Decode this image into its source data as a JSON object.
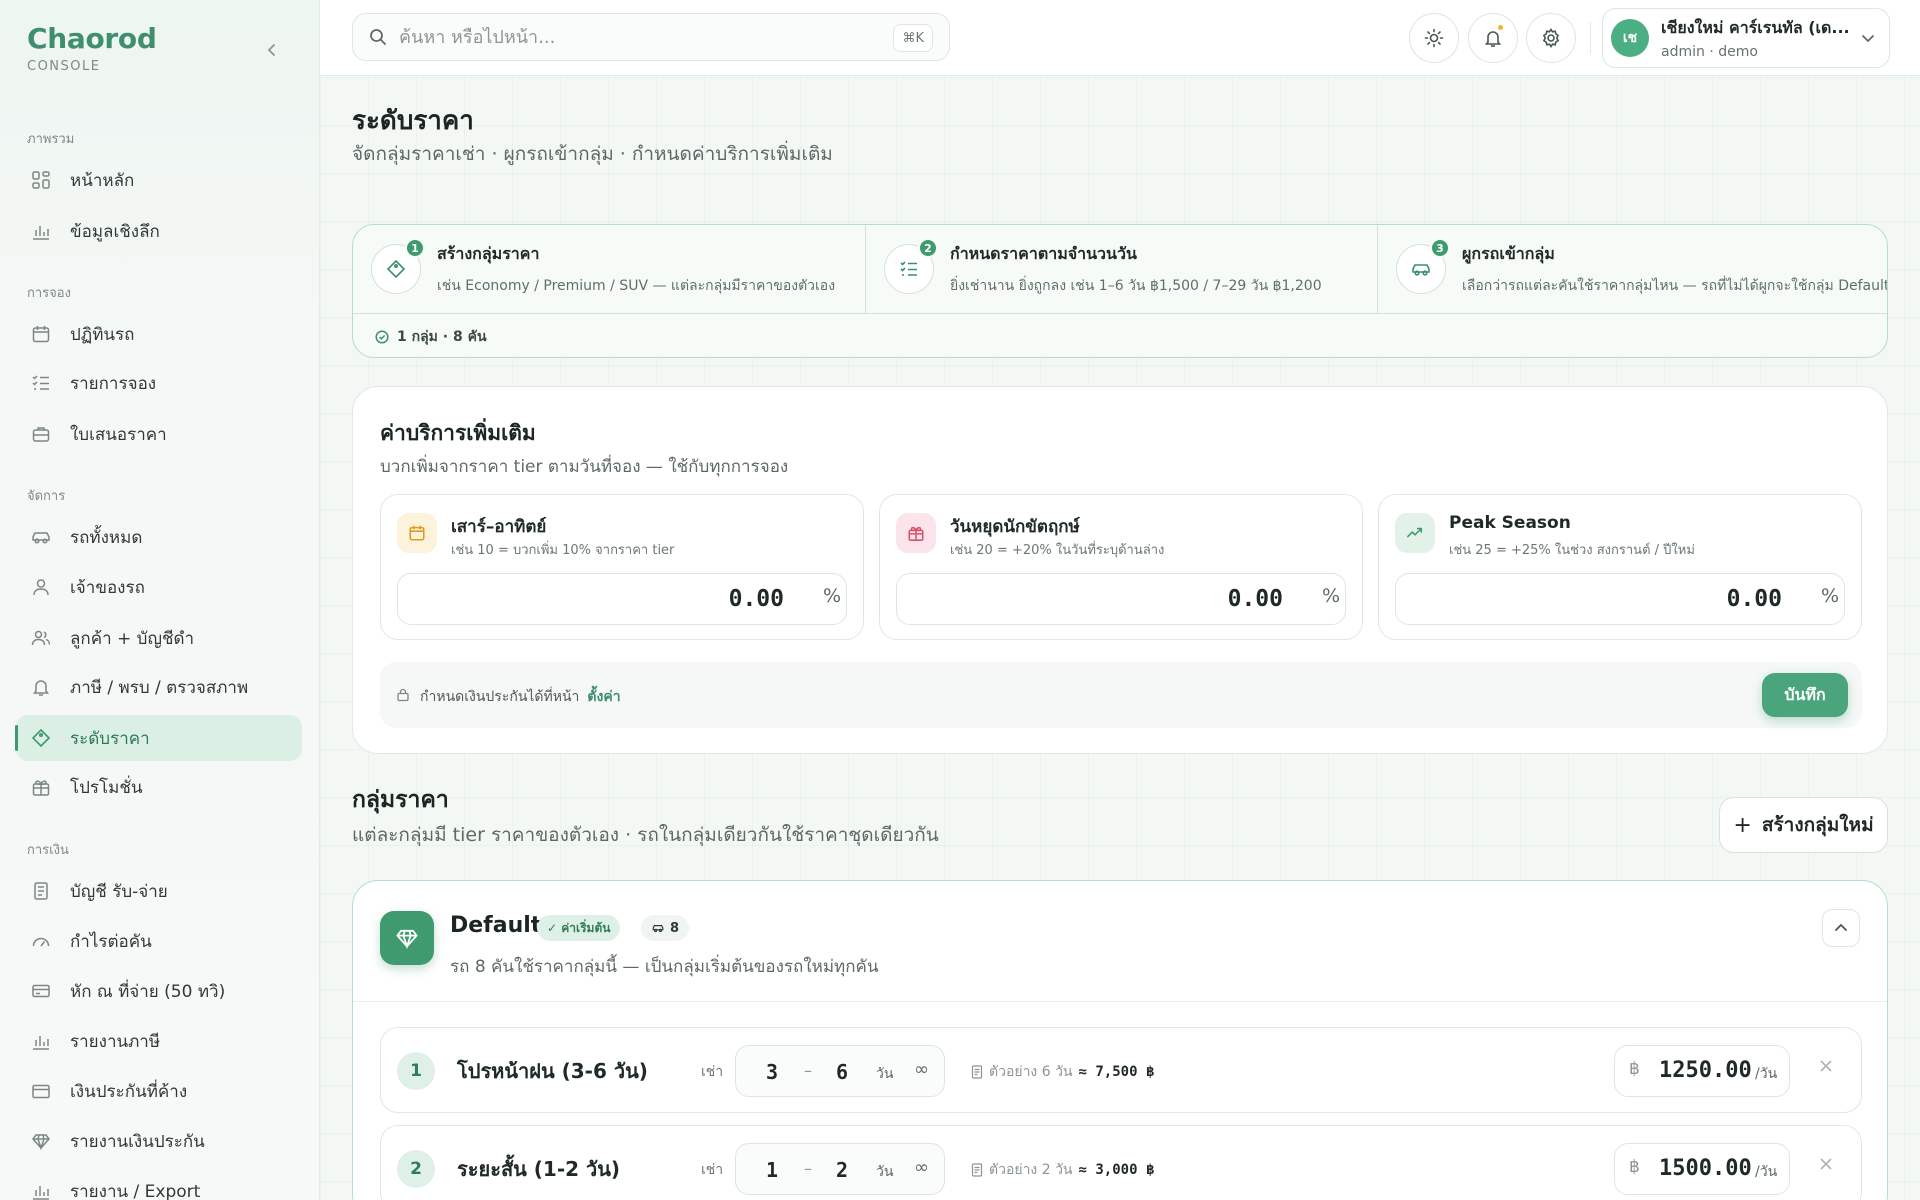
{
  "brand": {
    "name": "Chaorod",
    "sub": "CONSOLE"
  },
  "sidebar": {
    "sections": [
      {
        "label": "ภาพรวม"
      },
      {
        "label": "การจอง"
      },
      {
        "label": "จัดการ"
      },
      {
        "label": "การเงิน"
      }
    ],
    "items": [
      {
        "label": "หน้าหลัก",
        "icon": "grid-icon"
      },
      {
        "label": "ข้อมูลเชิงลึก",
        "icon": "bar-chart-icon"
      },
      {
        "label": "ปฏิทินรถ",
        "icon": "calendar-icon"
      },
      {
        "label": "รายการจอง",
        "icon": "list-check-icon"
      },
      {
        "label": "ใบเสนอราคา",
        "icon": "briefcase-icon"
      },
      {
        "label": "รถทั้งหมด",
        "icon": "car-icon"
      },
      {
        "label": "เจ้าของรถ",
        "icon": "user-icon"
      },
      {
        "label": "ลูกค้า + บัญชีดำ",
        "icon": "users-icon"
      },
      {
        "label": "ภาษี / พรบ / ตรวจสภาพ",
        "icon": "bell-icon"
      },
      {
        "label": "ระดับราคา",
        "icon": "tag-icon"
      },
      {
        "label": "โปรโมชั่น",
        "icon": "gift-icon"
      },
      {
        "label": "บัญชี รับ-จ่าย",
        "icon": "ledger-icon"
      },
      {
        "label": "กำไรต่อคัน",
        "icon": "gauge-icon"
      },
      {
        "label": "หัก ณ ที่จ่าย (50 ทวิ)",
        "icon": "card-icon"
      },
      {
        "label": "รายงานภาษี",
        "icon": "bar-chart-icon"
      },
      {
        "label": "เงินประกันที่ค้าง",
        "icon": "wallet-icon"
      },
      {
        "label": "รายงานเงินประกัน",
        "icon": "diamond-icon"
      },
      {
        "label": "รายงาน / Export",
        "icon": "bar-chart-icon"
      }
    ]
  },
  "topbar": {
    "search_placeholder": "ค้นหา หรือไปหน้า...",
    "search_kbd": "⌘K",
    "account_name": "เชียงใหม่ คาร์เรนทัล (เด...",
    "account_role": "admin · demo",
    "avatar_initials": "เช"
  },
  "page": {
    "title": "ระดับราคา",
    "subtitle": "จัดกลุ่มราคาเช่า · ผูกรถเข้ากลุ่ม · กำหนดค่าบริการเพิ่มเติม"
  },
  "steps": {
    "items": [
      {
        "num": "1",
        "title": "สร้างกลุ่มราคา",
        "desc": "เช่น Economy / Premium / SUV — แต่ละกลุ่มมีราคาของตัวเอง"
      },
      {
        "num": "2",
        "title": "กำหนดราคาตามจำนวนวัน",
        "desc": "ยิ่งเช่านาน ยิ่งถูกลง เช่น 1–6 วัน ฿1,500 / 7–29 วัน ฿1,200"
      },
      {
        "num": "3",
        "title": "ผูกรถเข้ากลุ่ม",
        "desc": "เลือกว่ารถแต่ละคันใช้ราคากลุ่มไหน — รถที่ไม่ได้ผูกจะใช้กลุ่ม Default"
      }
    ],
    "summary": "1 กลุ่ม · 8 คัน"
  },
  "fees": {
    "title": "ค่าบริการเพิ่มเติม",
    "subtitle": "บวกเพิ่มจากราคา tier ตามวันที่จอง — ใช้กับทุกการจอง",
    "items": [
      {
        "label": "เสาร์–อาทิตย์",
        "hint": "เช่น 10 = บวกเพิ่ม 10% จากราคา tier",
        "value": "0.00",
        "unit": "%",
        "color": "#f5a623"
      },
      {
        "label": "วันหยุดนักขัตฤกษ์",
        "hint": "เช่น 20 = +20% ในวันที่ระบุด้านล่าง",
        "value": "0.00",
        "unit": "%",
        "color": "#e0607a"
      },
      {
        "label": "Peak Season",
        "hint": "เช่น 25 = +25% ในช่วง สงกรานต์ / ปีใหม่",
        "value": "0.00",
        "unit": "%",
        "color": "#3d9a70"
      }
    ],
    "footer_text": "กำหนดเงินประกันได้ที่หน้า",
    "footer_link": "ตั้งค่า",
    "save_label": "บันทึก"
  },
  "groups": {
    "title": "กลุ่มราคา",
    "subtitle": "แต่ละกลุ่มมี tier ราคาของตัวเอง · รถในกลุ่มเดียวกันใช้ราคาชุดเดียวกัน",
    "new_label": "สร้างกลุ่มใหม่",
    "list": [
      {
        "name": "Default",
        "badge": "✓ ค่าเริ่มต้น",
        "car_count": "8",
        "desc": "รถ 8 คันใช้ราคากลุ่มนี้ — เป็นกลุ่มเริ่มต้นของรถใหม่ทุกคัน",
        "tiers": [
          {
            "num": "1",
            "name": "โปรหน้าฝน (3-6 วัน)",
            "rent_label": "เช่า",
            "min": "3",
            "max": "6",
            "day_label": "วัน",
            "inf": "∞",
            "example_label": "ตัวอย่าง 6 วัน",
            "example_total": "≈ 7,500 ฿",
            "currency": "฿",
            "price": "1250.00",
            "per": "/วัน"
          },
          {
            "num": "2",
            "name": "ระยะสั้น (1-2 วัน)",
            "rent_label": "เช่า",
            "min": "1",
            "max": "2",
            "day_label": "วัน",
            "inf": "∞",
            "example_label": "ตัวอย่าง 2 วัน",
            "example_total": "≈ 3,000 ฿",
            "currency": "฿",
            "price": "1500.00",
            "per": "/วัน"
          }
        ]
      }
    ]
  }
}
